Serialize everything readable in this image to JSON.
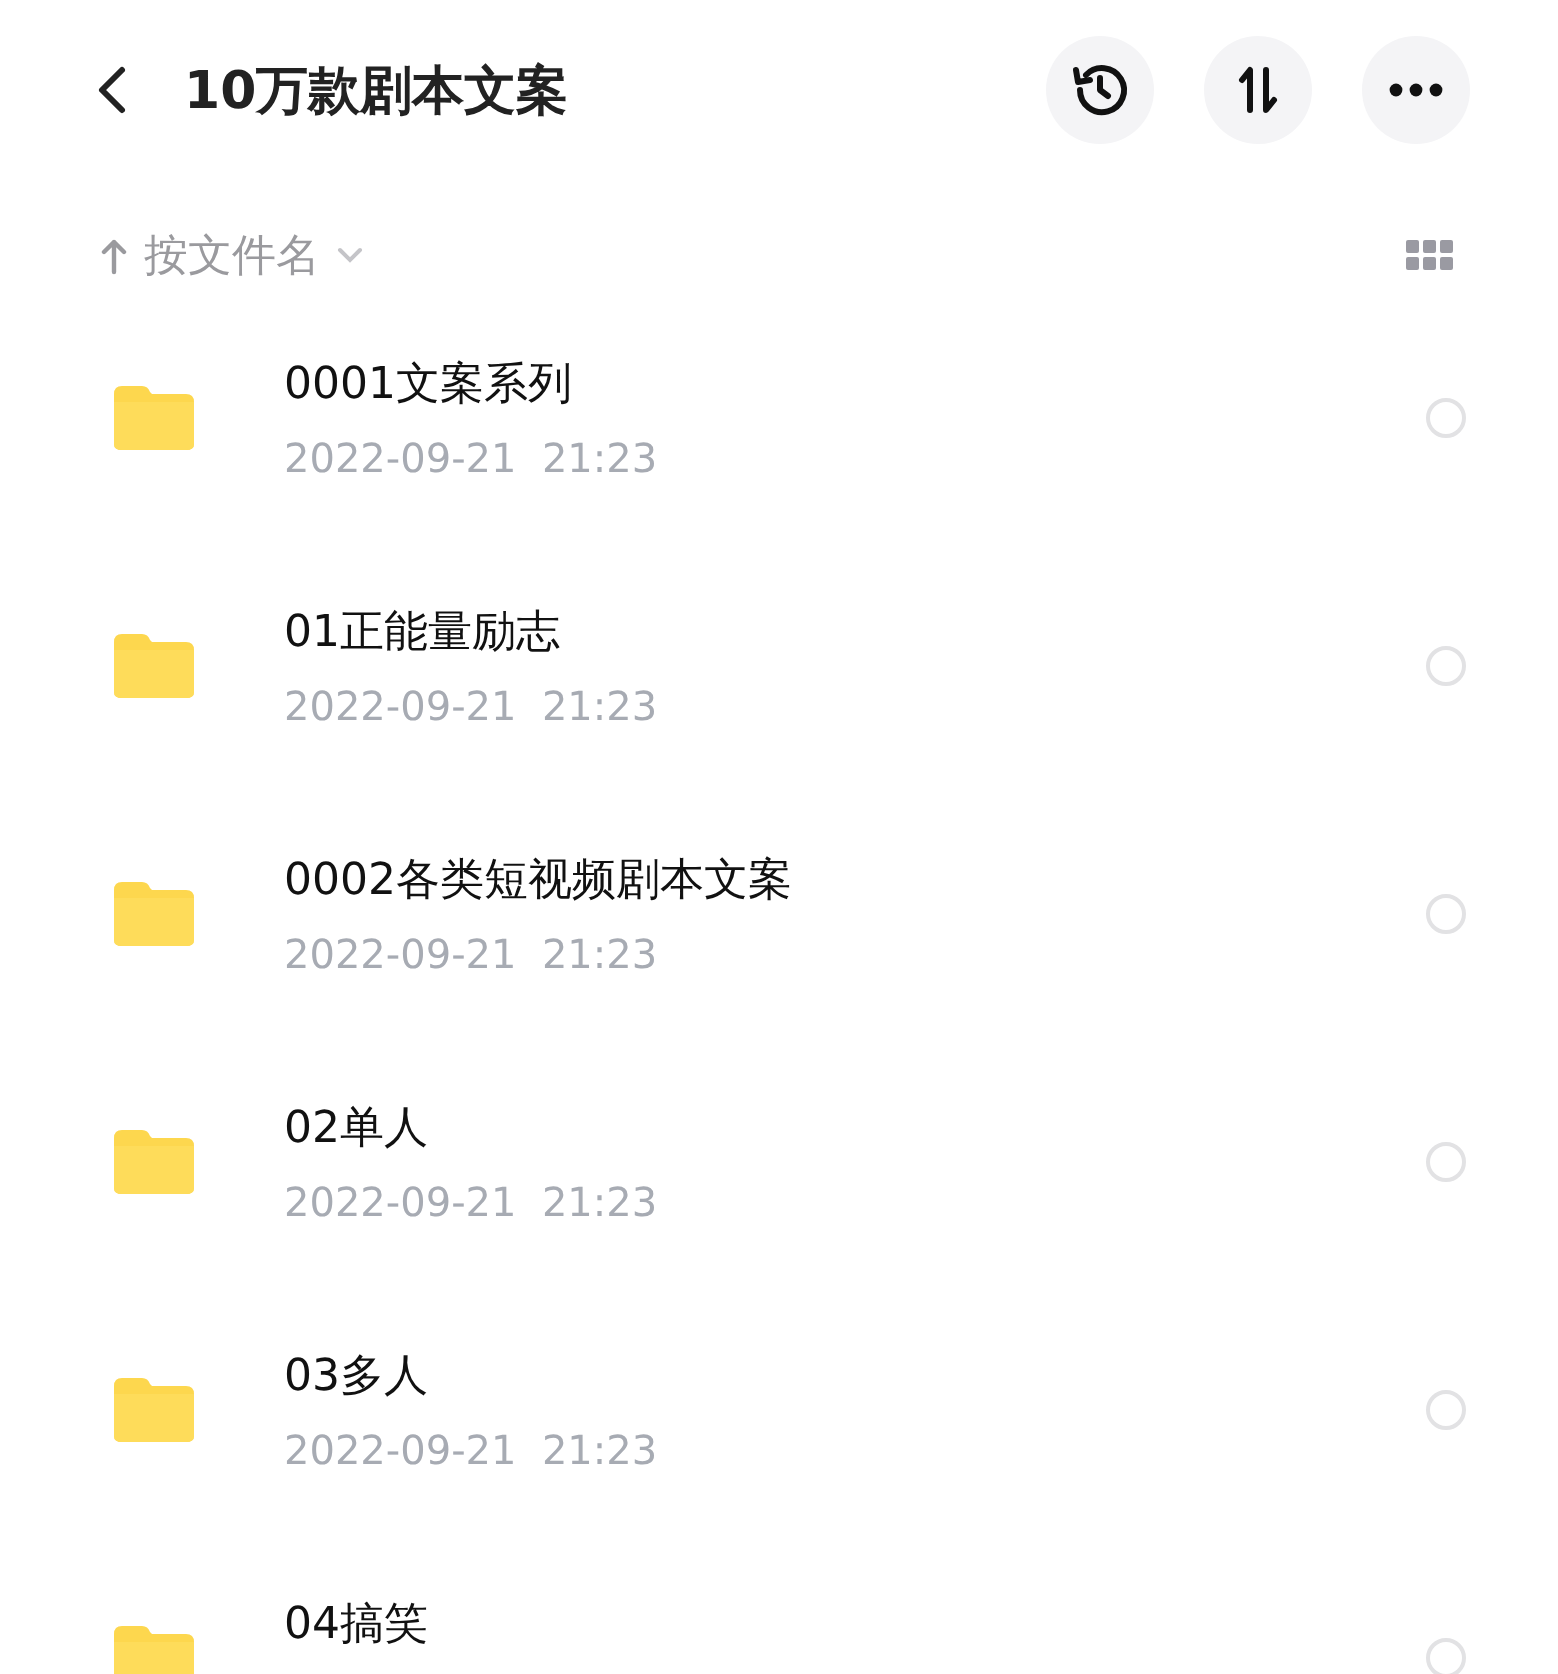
{
  "header": {
    "title": "10万款剧本文案"
  },
  "sort_bar": {
    "label": "按文件名"
  },
  "files": [
    {
      "name": "0001文案系列",
      "date": "2022-09-21  21:23",
      "selected": false
    },
    {
      "name": "01正能量励志",
      "date": "2022-09-21  21:23",
      "selected": false
    },
    {
      "name": "0002各类短视频剧本文案",
      "date": "2022-09-21  21:23",
      "selected": false
    },
    {
      "name": "02单人",
      "date": "2022-09-21  21:23",
      "selected": false
    },
    {
      "name": "03多人",
      "date": "2022-09-21  21:23",
      "selected": false
    },
    {
      "name": "04搞笑",
      "selected": false
    }
  ]
}
